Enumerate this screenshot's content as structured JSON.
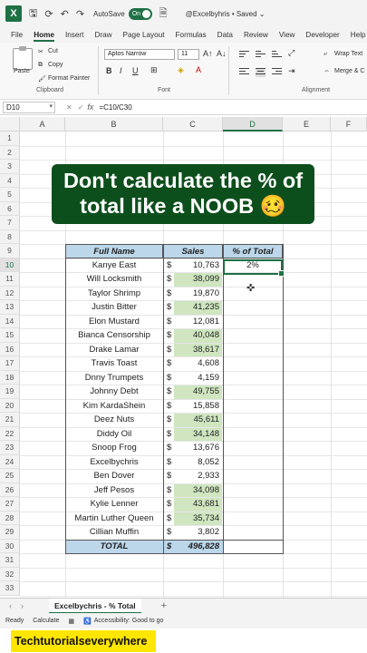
{
  "titlebar": {
    "app_icon": "X",
    "autosave_label": "AutoSave",
    "autosave_state": "On",
    "doc_title": "@Excelbyhris • Saved ⌄"
  },
  "menu": [
    "File",
    "Home",
    "Insert",
    "Draw",
    "Page Layout",
    "Formulas",
    "Data",
    "Review",
    "View",
    "Developer",
    "Help"
  ],
  "ribbon": {
    "paste": "Paste",
    "cut": "Cut",
    "copy": "Copy",
    "format_painter": "Format Painter",
    "clipboard": "Clipboard",
    "font_name": "Aptos Narrow",
    "font_size": "11",
    "font_group": "Font",
    "bold": "B",
    "italic": "I",
    "underline": "U",
    "wrap_text": "Wrap Text",
    "merge": "Merge & C",
    "alignment": "Alignment"
  },
  "formula_bar": {
    "cell_ref": "D10",
    "fx": "fx",
    "formula": "=C10/C30"
  },
  "columns": [
    "A",
    "B",
    "C",
    "D",
    "E",
    "F"
  ],
  "rows": [
    "1",
    "2",
    "3",
    "4",
    "5",
    "6",
    "7",
    "8",
    "9",
    "10",
    "11",
    "12",
    "13",
    "14",
    "15",
    "16",
    "17",
    "18",
    "19",
    "20",
    "21",
    "22",
    "23",
    "24",
    "25",
    "26",
    "27",
    "28",
    "29",
    "30",
    "31",
    "32",
    "33"
  ],
  "banner": {
    "line1": "Don't calculate the % of",
    "line2": "total like a NOOB 🥴"
  },
  "table": {
    "headers": [
      "Full Name",
      "Sales",
      "% of Total"
    ],
    "rows": [
      {
        "name": "Kanye East",
        "dollar": "$",
        "sales": "10,763",
        "highlight": false,
        "pct": "2%"
      },
      {
        "name": "Will Locksmith",
        "dollar": "$",
        "sales": "38,099",
        "highlight": true,
        "pct": ""
      },
      {
        "name": "Taylor Shrimp",
        "dollar": "$",
        "sales": "19,870",
        "highlight": false,
        "pct": ""
      },
      {
        "name": "Justin Bitter",
        "dollar": "$",
        "sales": "41,235",
        "highlight": true,
        "pct": ""
      },
      {
        "name": "Elon Mustard",
        "dollar": "$",
        "sales": "12,081",
        "highlight": false,
        "pct": ""
      },
      {
        "name": "Bianca Censorship",
        "dollar": "$",
        "sales": "40,048",
        "highlight": true,
        "pct": ""
      },
      {
        "name": "Drake Lamar",
        "dollar": "$",
        "sales": "38,617",
        "highlight": true,
        "pct": ""
      },
      {
        "name": "Travis Toast",
        "dollar": "$",
        "sales": "4,608",
        "highlight": false,
        "pct": ""
      },
      {
        "name": "Dnny Trumpets",
        "dollar": "$",
        "sales": "4,159",
        "highlight": false,
        "pct": ""
      },
      {
        "name": "Johnny Debt",
        "dollar": "$",
        "sales": "49,755",
        "highlight": true,
        "pct": ""
      },
      {
        "name": "Kim KardaShein",
        "dollar": "$",
        "sales": "15,858",
        "highlight": false,
        "pct": ""
      },
      {
        "name": "Deez Nuts",
        "dollar": "$",
        "sales": "45,611",
        "highlight": true,
        "pct": ""
      },
      {
        "name": "Diddy Oil",
        "dollar": "$",
        "sales": "34,148",
        "highlight": true,
        "pct": ""
      },
      {
        "name": "Snoop Frog",
        "dollar": "$",
        "sales": "13,676",
        "highlight": false,
        "pct": ""
      },
      {
        "name": "Excelbychris",
        "dollar": "$",
        "sales": "8,052",
        "highlight": false,
        "pct": ""
      },
      {
        "name": "Ben Dover",
        "dollar": "$",
        "sales": "2,933",
        "highlight": false,
        "pct": ""
      },
      {
        "name": "Jeff Pesos",
        "dollar": "$",
        "sales": "34,098",
        "highlight": true,
        "pct": ""
      },
      {
        "name": "Kylie Lenner",
        "dollar": "$",
        "sales": "43,681",
        "highlight": true,
        "pct": ""
      },
      {
        "name": "Martin Luther Queen",
        "dollar": "$",
        "sales": "35,734",
        "highlight": true,
        "pct": ""
      },
      {
        "name": "Cillian Muffin",
        "dollar": "$",
        "sales": "3,802",
        "highlight": false,
        "pct": ""
      }
    ],
    "total_label": "TOTAL",
    "total_dollar": "$",
    "total_value": "496,828"
  },
  "sheet_tab": "Excelbychris - % Total",
  "status": {
    "ready": "Ready",
    "calculate": "Calculate",
    "accessibility": "Accessibility: Good to go"
  },
  "watermark": "Techtutorialseverywhere",
  "colors": {
    "accent": "#1e7145",
    "banner": "#0d4f1c",
    "table_header": "#bcd7ea",
    "sales_highlight": "#cfe6c0",
    "watermark": "#ffe600"
  }
}
